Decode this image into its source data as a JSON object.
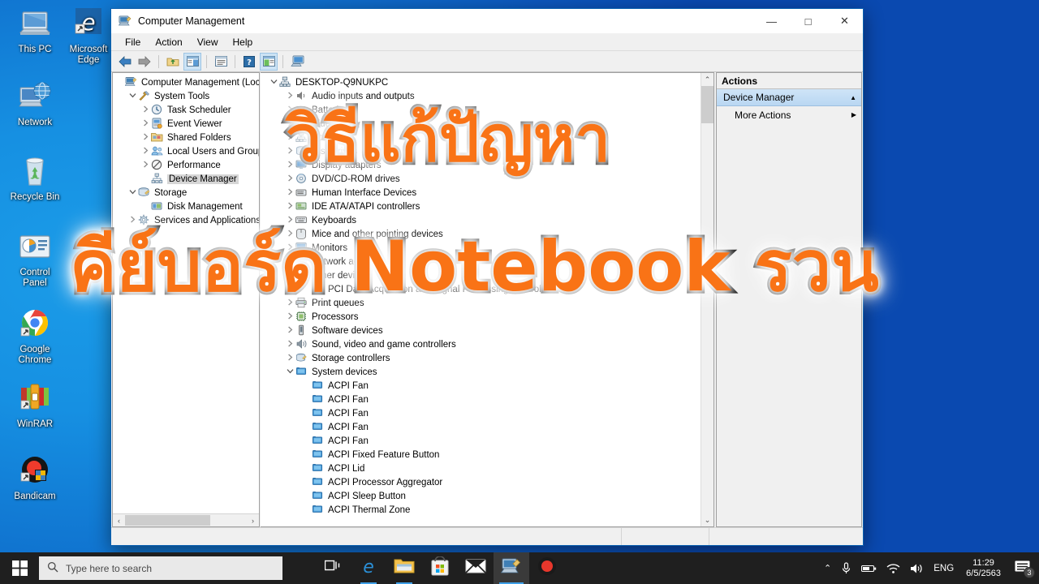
{
  "desktop": {
    "icons": [
      {
        "name": "this-pc",
        "label": "This PC"
      },
      {
        "name": "microsoft-edge",
        "label": "Microsoft\nEdge"
      },
      {
        "name": "network",
        "label": "Network"
      },
      {
        "name": "recycle-bin",
        "label": "Recycle Bin"
      },
      {
        "name": "control-panel",
        "label": "Control\nPanel"
      },
      {
        "name": "google-chrome",
        "label": "Google\nChrome"
      },
      {
        "name": "winrar",
        "label": "WinRAR"
      },
      {
        "name": "bandicam",
        "label": "Bandicam"
      }
    ]
  },
  "window": {
    "title": "Computer Management",
    "icon": "computer-management-icon",
    "controls": {
      "minimize": "—",
      "maximize": "□",
      "close": "✕"
    },
    "menu": [
      "File",
      "Action",
      "View",
      "Help"
    ],
    "toolbar": [
      "back-arrow-icon",
      "forward-arrow-icon",
      "up-folder-icon",
      "show-hide-console-tree-icon",
      "properties-icon",
      "help-icon",
      "show-hide-action-pane-icon",
      "scan-for-hardware-changes-icon"
    ]
  },
  "left_tree": {
    "items": [
      {
        "label": "Computer Management (Local",
        "depth": 0,
        "expander": "",
        "icon": "computer-management-icon",
        "selected": false
      },
      {
        "label": "System Tools",
        "depth": 1,
        "expander": "v",
        "icon": "system-tools-icon",
        "selected": false
      },
      {
        "label": "Task Scheduler",
        "depth": 2,
        "expander": ">",
        "icon": "task-scheduler-icon",
        "selected": false
      },
      {
        "label": "Event Viewer",
        "depth": 2,
        "expander": ">",
        "icon": "event-viewer-icon",
        "selected": false
      },
      {
        "label": "Shared Folders",
        "depth": 2,
        "expander": ">",
        "icon": "shared-folders-icon",
        "selected": false
      },
      {
        "label": "Local Users and Groups",
        "depth": 2,
        "expander": ">",
        "icon": "local-users-icon",
        "selected": false
      },
      {
        "label": "Performance",
        "depth": 2,
        "expander": ">",
        "icon": "performance-icon",
        "selected": false
      },
      {
        "label": "Device Manager",
        "depth": 2,
        "expander": "",
        "icon": "device-manager-icon",
        "selected": true
      },
      {
        "label": "Storage",
        "depth": 1,
        "expander": "v",
        "icon": "storage-icon",
        "selected": false
      },
      {
        "label": "Disk Management",
        "depth": 2,
        "expander": "",
        "icon": "disk-management-icon",
        "selected": false
      },
      {
        "label": "Services and Applications",
        "depth": 1,
        "expander": ">",
        "icon": "services-icon",
        "selected": false
      }
    ],
    "hscroll": {
      "left_arrow": "‹",
      "right_arrow": "›"
    }
  },
  "device_tree": {
    "items": [
      {
        "label": "DESKTOP-Q9NUKPC",
        "depth": 0,
        "expander": "v",
        "icon": "computer-icon"
      },
      {
        "label": "Audio inputs and outputs",
        "depth": 1,
        "expander": ">",
        "icon": "audio-icon"
      },
      {
        "label": "Batteries",
        "depth": 1,
        "expander": ">",
        "icon": "battery-icon"
      },
      {
        "label": "Bluetooth",
        "depth": 1,
        "expander": ">",
        "icon": "bluetooth-icon"
      },
      {
        "label": "Computer",
        "depth": 1,
        "expander": ">",
        "icon": "computer-icon"
      },
      {
        "label": "Disk drives",
        "depth": 1,
        "expander": ">",
        "icon": "disk-icon"
      },
      {
        "label": "Display adapters",
        "depth": 1,
        "expander": ">",
        "icon": "display-adapter-icon"
      },
      {
        "label": "DVD/CD-ROM drives",
        "depth": 1,
        "expander": ">",
        "icon": "dvd-icon"
      },
      {
        "label": "Human Interface Devices",
        "depth": 1,
        "expander": ">",
        "icon": "hid-icon"
      },
      {
        "label": "IDE ATA/ATAPI controllers",
        "depth": 1,
        "expander": ">",
        "icon": "ide-icon"
      },
      {
        "label": "Keyboards",
        "depth": 1,
        "expander": ">",
        "icon": "keyboard-icon"
      },
      {
        "label": "Mice and other pointing devices",
        "depth": 1,
        "expander": ">",
        "icon": "mouse-icon"
      },
      {
        "label": "Monitors",
        "depth": 1,
        "expander": ">",
        "icon": "monitor-icon"
      },
      {
        "label": "Network adapters",
        "depth": 1,
        "expander": ">",
        "icon": "network-adapter-icon"
      },
      {
        "label": "Other devices",
        "depth": 1,
        "expander": "v",
        "icon": "other-devices-icon"
      },
      {
        "label": "PCI Data Acquisition and Signal Processing Controller",
        "depth": 2,
        "expander": "",
        "icon": "warning-device-icon"
      },
      {
        "label": "Print queues",
        "depth": 1,
        "expander": ">",
        "icon": "printer-icon"
      },
      {
        "label": "Processors",
        "depth": 1,
        "expander": ">",
        "icon": "processor-icon"
      },
      {
        "label": "Software devices",
        "depth": 1,
        "expander": ">",
        "icon": "software-device-icon"
      },
      {
        "label": "Sound, video and game controllers",
        "depth": 1,
        "expander": ">",
        "icon": "sound-icon"
      },
      {
        "label": "Storage controllers",
        "depth": 1,
        "expander": ">",
        "icon": "storage-controller-icon"
      },
      {
        "label": "System devices",
        "depth": 1,
        "expander": "v",
        "icon": "system-device-icon"
      },
      {
        "label": "ACPI Fan",
        "depth": 2,
        "expander": "",
        "icon": "system-device-icon"
      },
      {
        "label": "ACPI Fan",
        "depth": 2,
        "expander": "",
        "icon": "system-device-icon"
      },
      {
        "label": "ACPI Fan",
        "depth": 2,
        "expander": "",
        "icon": "system-device-icon"
      },
      {
        "label": "ACPI Fan",
        "depth": 2,
        "expander": "",
        "icon": "system-device-icon"
      },
      {
        "label": "ACPI Fan",
        "depth": 2,
        "expander": "",
        "icon": "system-device-icon"
      },
      {
        "label": "ACPI Fixed Feature Button",
        "depth": 2,
        "expander": "",
        "icon": "system-device-icon"
      },
      {
        "label": "ACPI Lid",
        "depth": 2,
        "expander": "",
        "icon": "system-device-icon"
      },
      {
        "label": "ACPI Processor Aggregator",
        "depth": 2,
        "expander": "",
        "icon": "system-device-icon"
      },
      {
        "label": "ACPI Sleep Button",
        "depth": 2,
        "expander": "",
        "icon": "system-device-icon"
      },
      {
        "label": "ACPI Thermal Zone",
        "depth": 2,
        "expander": "",
        "icon": "system-device-icon"
      }
    ],
    "scroll": {
      "up_arrow": "⌃",
      "down_arrow": "⌄"
    }
  },
  "actions": {
    "header": "Actions",
    "group": {
      "label": "Device Manager",
      "chevron": "▲"
    },
    "items": [
      {
        "label": "More Actions",
        "chevron": "▶"
      }
    ]
  },
  "overlay": {
    "line1": "วิธีแก้ปัญหา",
    "line2": "คีย์บอร์ด Notebook รวน",
    "fill_color": "#F97316",
    "stroke_color": "#000000",
    "glow_color": "#FFFFFF"
  },
  "taskbar": {
    "start": "start-icon",
    "search_placeholder": "Type here to search",
    "search_value": "",
    "buttons": [
      {
        "name": "task-view-icon",
        "state": "idle"
      },
      {
        "name": "microsoft-edge-icon",
        "state": "running"
      },
      {
        "name": "file-explorer-icon",
        "state": "running"
      },
      {
        "name": "microsoft-store-icon",
        "state": "idle"
      },
      {
        "name": "mail-icon",
        "state": "idle"
      },
      {
        "name": "computer-management-icon",
        "state": "active"
      },
      {
        "name": "bandicam-icon",
        "state": "idle"
      }
    ],
    "tray": {
      "show_hidden": "⌃",
      "icons": [
        "microphone-icon",
        "battery-icon",
        "wifi-icon",
        "speaker-icon"
      ],
      "language": "ENG",
      "time": "11:29",
      "date": "6/5/2563",
      "notification_count": "3"
    }
  }
}
